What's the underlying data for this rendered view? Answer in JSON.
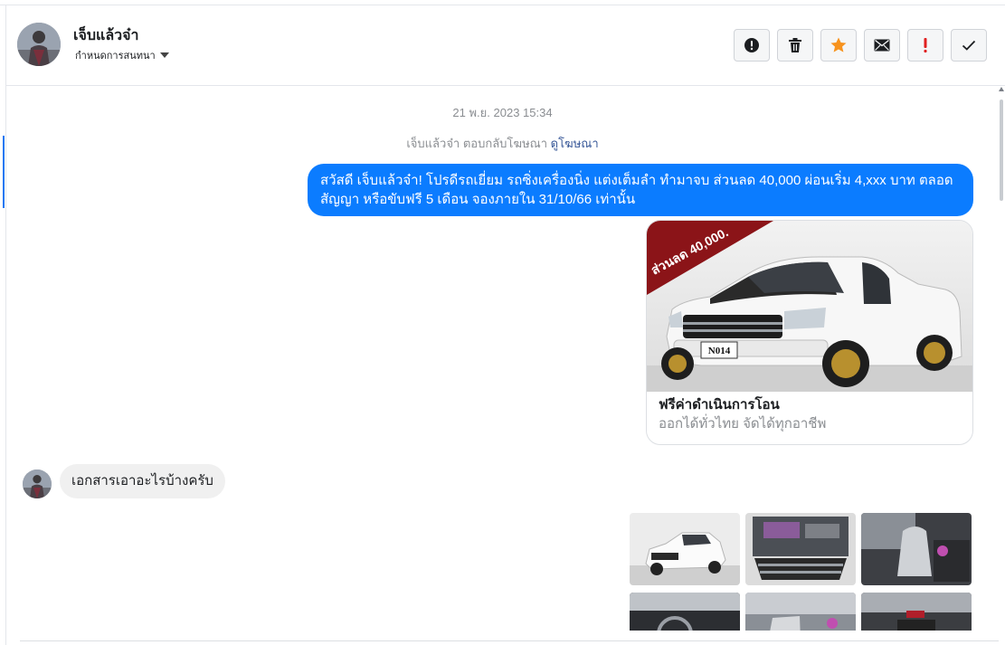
{
  "header": {
    "name": "เจ็บแล้วจ๋า",
    "assign_label": "กำหนดการสนทนา",
    "actions": [
      {
        "icon": "alert-circle-icon",
        "label": "spam"
      },
      {
        "icon": "trash-icon",
        "label": "delete"
      },
      {
        "icon": "star-icon",
        "label": "star"
      },
      {
        "icon": "envelope-icon",
        "label": "mark-unread"
      },
      {
        "icon": "exclamation-icon",
        "label": "important"
      },
      {
        "icon": "check-icon",
        "label": "done"
      }
    ]
  },
  "conversation": {
    "timestamp": "21 พ.ย. 2023 15:34",
    "reply_note": "เจ็บแล้วจ๋า ตอบกลับโฆษณา",
    "reply_link": "ดูโฆษณา",
    "outgoing_message": "สวัสดี เจ็บแล้วจ๋า! โปรดีรถเยี่ยม รถซิ่งเครื่องนิ่ง แต่งเต็มลำ ทำมาจบ ส่วนลด 40,000 ผ่อนเริ่ม 4,xxx บาท ตลอดสัญญา หรือขับฟรี 5 เดือน จองภายใน 31/10/66 เท่านั้น",
    "ad": {
      "banner_text": "ส่วนลด 40,000.",
      "plate": "N014",
      "title": "ฟรีค่าดำเนินการโอน",
      "subtitle": "ออกได้ทั่วไทย จัดได้ทุกอาชีพ"
    },
    "incoming_message": "เอกสารเอาอะไรบ้างครับ"
  },
  "colors": {
    "bubble_out": "#0b7cff",
    "bubble_in": "#f0f0f0",
    "star": "#f7931e",
    "important": "#e02020",
    "link": "#385898"
  }
}
